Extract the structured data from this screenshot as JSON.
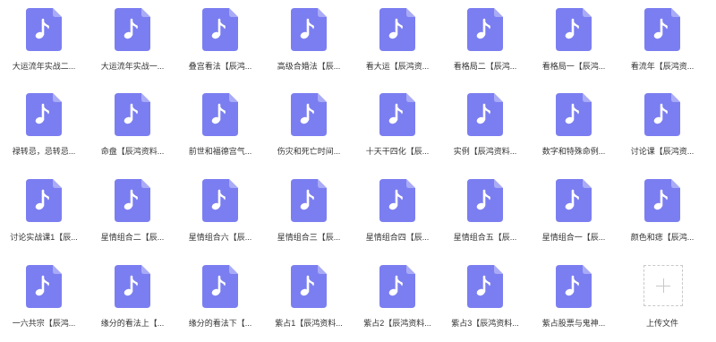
{
  "files": [
    {
      "label": "大运流年实战二..."
    },
    {
      "label": "大运流年实战一..."
    },
    {
      "label": "叠宫看法【辰鸿..."
    },
    {
      "label": "高级合婚法【辰..."
    },
    {
      "label": "看大运【辰鸿资..."
    },
    {
      "label": "看格局二【辰鸿..."
    },
    {
      "label": "看格局一【辰鸿..."
    },
    {
      "label": "看流年【辰鸿资..."
    },
    {
      "label": "禄转忌，忌转忌..."
    },
    {
      "label": "命盘【辰鸿资料..."
    },
    {
      "label": "前世和福德宫气..."
    },
    {
      "label": "伤灾和死亡时间..."
    },
    {
      "label": "十天干四化【辰..."
    },
    {
      "label": "实例【辰鸿资料..."
    },
    {
      "label": "数字和特殊命例..."
    },
    {
      "label": "讨论课【辰鸿资..."
    },
    {
      "label": "讨论实战课1【辰..."
    },
    {
      "label": "星情组合二【辰..."
    },
    {
      "label": "星情组合六【辰..."
    },
    {
      "label": "星情组合三【辰..."
    },
    {
      "label": "星情组合四【辰..."
    },
    {
      "label": "星情组合五【辰..."
    },
    {
      "label": "星情组合一【辰..."
    },
    {
      "label": "颜色和痣【辰鸿..."
    },
    {
      "label": "一六共宗【辰鸿..."
    },
    {
      "label": "缘分的看法上【..."
    },
    {
      "label": "缘分的看法下【..."
    },
    {
      "label": "紫占1【辰鸿资料..."
    },
    {
      "label": "紫占2【辰鸿资料..."
    },
    {
      "label": "紫占3【辰鸿资料..."
    },
    {
      "label": "紫占股票与鬼神..."
    }
  ],
  "upload": {
    "label": "上传文件"
  },
  "icon": {
    "name": "music-file-icon",
    "color": "#7b7ef0",
    "fold_color": "#a9abf7",
    "note_color": "#ffffff"
  }
}
